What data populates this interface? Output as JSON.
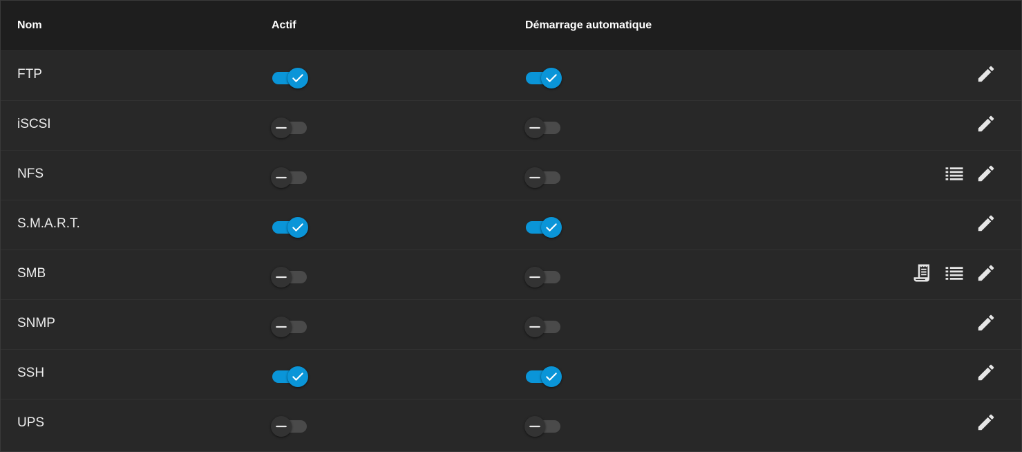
{
  "columns": {
    "name": "Nom",
    "active": "Actif",
    "autostart": "Démarrage automatique"
  },
  "services": [
    {
      "name": "FTP",
      "active": true,
      "autostart": true,
      "actions": [
        "edit-icon"
      ]
    },
    {
      "name": "iSCSI",
      "active": false,
      "autostart": false,
      "actions": [
        "edit-icon"
      ]
    },
    {
      "name": "NFS",
      "active": false,
      "autostart": false,
      "actions": [
        "list-icon",
        "edit-icon"
      ]
    },
    {
      "name": "S.M.A.R.T.",
      "active": true,
      "autostart": true,
      "actions": [
        "edit-icon"
      ]
    },
    {
      "name": "SMB",
      "active": false,
      "autostart": false,
      "actions": [
        "receipt-icon",
        "list-icon",
        "edit-icon"
      ]
    },
    {
      "name": "SNMP",
      "active": false,
      "autostart": false,
      "actions": [
        "edit-icon"
      ]
    },
    {
      "name": "SSH",
      "active": true,
      "autostart": true,
      "actions": [
        "edit-icon"
      ]
    },
    {
      "name": "UPS",
      "active": false,
      "autostart": false,
      "actions": [
        "edit-icon"
      ]
    }
  ],
  "colors": {
    "toggle_on": "#0a95d8",
    "toggle_off_track": "#4a4a4a",
    "header_bg": "#1e1e1e",
    "row_bg": "#282828"
  }
}
